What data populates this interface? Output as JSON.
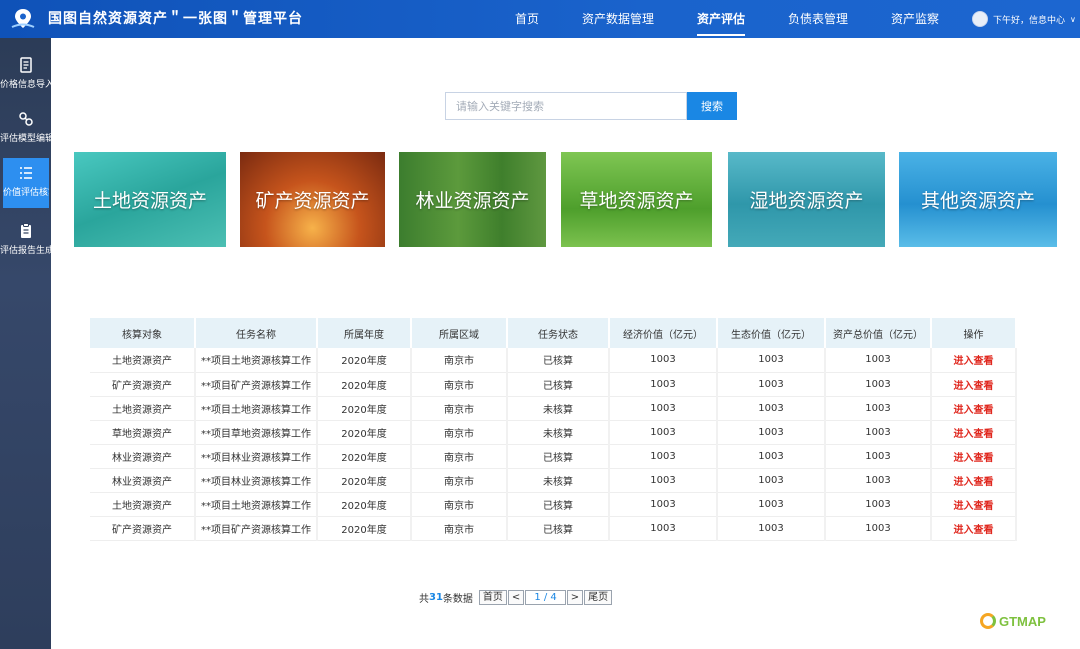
{
  "header": {
    "title": "国图自然资源资产＂一张图＂管理平台",
    "nav": [
      "首页",
      "资产数据管理",
      "资产评估",
      "负债表管理",
      "资产监察"
    ],
    "active_nav": "资产评估",
    "user_greeting": "下午好，信息中心"
  },
  "sidebar": {
    "items": [
      {
        "label": "价格信息导入",
        "icon": "document-icon"
      },
      {
        "label": "评估模型编辑",
        "icon": "model-icon"
      },
      {
        "label": "价值评估核算",
        "icon": "list-icon",
        "active": true
      },
      {
        "label": "评估报告生成",
        "icon": "report-icon"
      }
    ]
  },
  "search": {
    "placeholder": "请输入关键字搜索",
    "button_label": "搜索"
  },
  "categories": [
    "土地资源资产",
    "矿产资源资产",
    "林业资源资产",
    "草地资源资产",
    "湿地资源资产",
    "其他资源资产"
  ],
  "table": {
    "headers": [
      "核算对象",
      "任务名称",
      "所属年度",
      "所属区域",
      "任务状态",
      "经济价值（亿元）",
      "生态价值（亿元）",
      "资产总价值（亿元）",
      "操作"
    ],
    "rows": [
      [
        "土地资源资产",
        "**项目土地资源核算工作",
        "2020年度",
        "南京市",
        "已核算",
        "1003",
        "1003",
        "1003",
        "进入查看"
      ],
      [
        "矿产资源资产",
        "**项目矿产资源核算工作",
        "2020年度",
        "南京市",
        "已核算",
        "1003",
        "1003",
        "1003",
        "进入查看"
      ],
      [
        "土地资源资产",
        "**项目土地资源核算工作",
        "2020年度",
        "南京市",
        "未核算",
        "1003",
        "1003",
        "1003",
        "进入查看"
      ],
      [
        "草地资源资产",
        "**项目草地资源核算工作",
        "2020年度",
        "南京市",
        "未核算",
        "1003",
        "1003",
        "1003",
        "进入查看"
      ],
      [
        "林业资源资产",
        "**项目林业资源核算工作",
        "2020年度",
        "南京市",
        "已核算",
        "1003",
        "1003",
        "1003",
        "进入查看"
      ],
      [
        "林业资源资产",
        "**项目林业资源核算工作",
        "2020年度",
        "南京市",
        "未核算",
        "1003",
        "1003",
        "1003",
        "进入查看"
      ],
      [
        "土地资源资产",
        "**项目土地资源核算工作",
        "2020年度",
        "南京市",
        "已核算",
        "1003",
        "1003",
        "1003",
        "进入查看"
      ],
      [
        "矿产资源资产",
        "**项目矿产资源核算工作",
        "2020年度",
        "南京市",
        "已核算",
        "1003",
        "1003",
        "1003",
        "进入查看"
      ]
    ]
  },
  "pagination": {
    "prefix": "共",
    "total": "31",
    "suffix": "条数据",
    "first": "首页",
    "prev": "<",
    "page_info": "1 / 4",
    "next": ">",
    "last": "尾页"
  },
  "brand": "GTMAP",
  "colors": {
    "header": "#1a63cc",
    "sidebar": "#2e3e5c",
    "accent": "#1a87e4",
    "link": "#e0271e",
    "table_header": "#e6f2f8"
  }
}
